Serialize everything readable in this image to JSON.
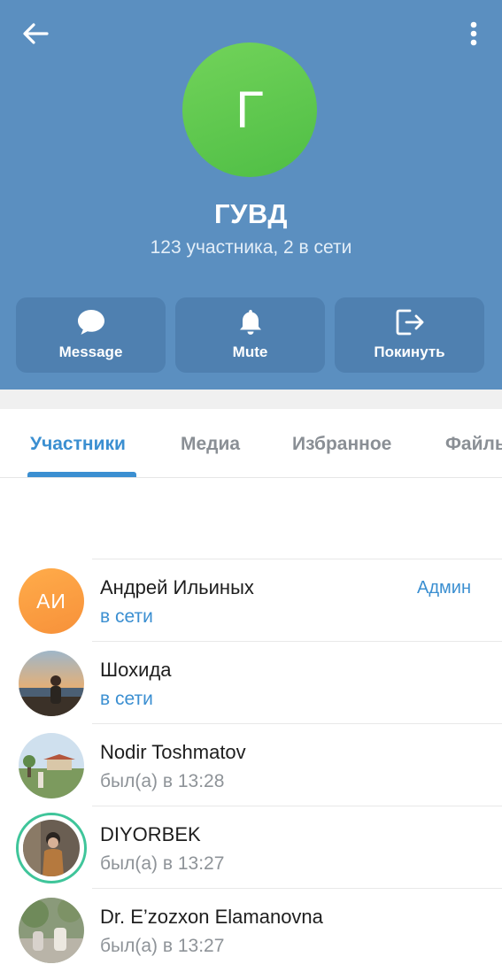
{
  "header": {
    "back_icon": "arrow-left-icon",
    "more_icon": "more-vertical-icon",
    "avatar_letter": "Г",
    "avatar_color": "#5ec64e",
    "title": "ГУВД",
    "subtitle": "123 участника, 2 в сети",
    "background": "#5b8fc0"
  },
  "actions": [
    {
      "label": "Message",
      "icon": "message-bubble-icon"
    },
    {
      "label": "Mute",
      "icon": "bell-icon"
    },
    {
      "label": "Покинуть",
      "icon": "leave-icon"
    }
  ],
  "tabs": [
    {
      "label": "Участники",
      "active": true
    },
    {
      "label": "Медиа",
      "active": false
    },
    {
      "label": "Избранное",
      "active": false
    },
    {
      "label": "Файлы",
      "active": false
    }
  ],
  "members": [
    {
      "name": "Андрей Ильиных",
      "status": "в сети",
      "online": true,
      "role": "Админ",
      "initials": "АИ"
    },
    {
      "name": "Шохида",
      "status": "в сети",
      "online": true
    },
    {
      "name": "Nodir Toshmatov",
      "status": "был(а) в 13:28",
      "online": false
    },
    {
      "name": "DIYORBEK",
      "status": "был(а) в 13:27",
      "online": false
    },
    {
      "name": "Dr. E’zozxon Elamanovna",
      "status": "был(а) в 13:27",
      "online": false
    }
  ],
  "colors": {
    "accent": "#3b8fd1",
    "header_bg": "#5b8fc0",
    "button_bg": "#4f80b0"
  }
}
